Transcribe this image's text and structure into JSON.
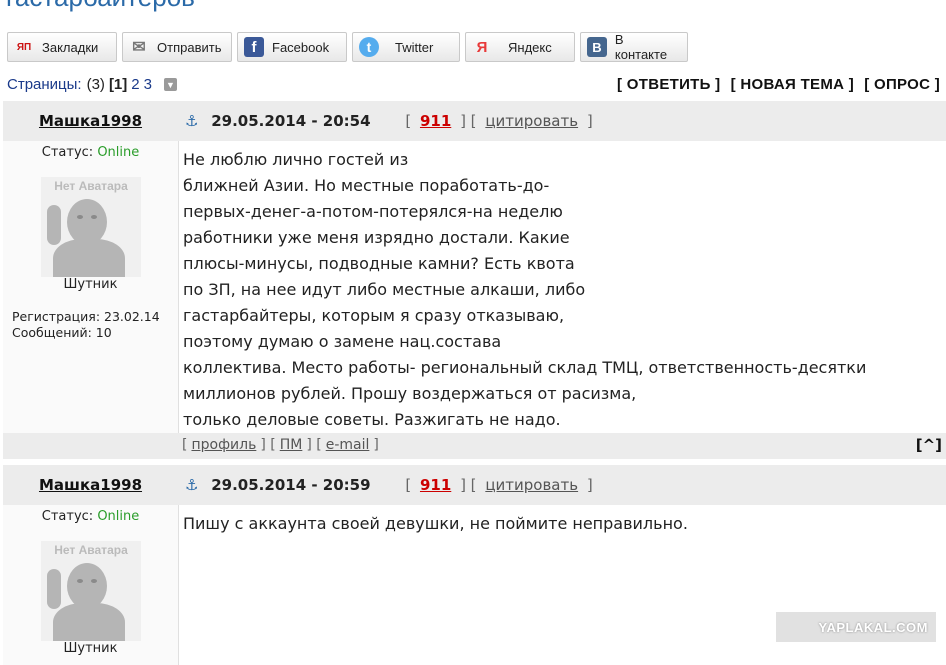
{
  "page": {
    "title_partial": "гастарбайтеров"
  },
  "share": [
    {
      "label": "Закладки",
      "icon": "yap-icon",
      "glyph": "ЯП",
      "color": "#cc1111"
    },
    {
      "label": "Отправить",
      "icon": "mail-icon",
      "glyph": "✉",
      "color": "#888888"
    },
    {
      "label": "Facebook",
      "icon": "facebook-icon",
      "glyph": "f",
      "color": "#3b5998"
    },
    {
      "label": "Twitter",
      "icon": "twitter-icon",
      "glyph": "t",
      "color": "#55acee"
    },
    {
      "label": "Яндекс",
      "icon": "yandex-icon",
      "glyph": "Я",
      "color": "#e83a3a"
    },
    {
      "label": "В контакте",
      "icon": "vk-icon",
      "glyph": "B",
      "color": "#45668e"
    }
  ],
  "pager": {
    "label": "Страницы:",
    "count": "(3)",
    "current": "[1]",
    "page2": "2",
    "page3": "3"
  },
  "actions": {
    "reply": "[ ОТВЕТИТЬ ]",
    "new_topic": "[ НОВАЯ ТЕМА ]",
    "poll": "[ ОПРОС ]"
  },
  "posts": [
    {
      "author": "Машка1998",
      "anchor": "⚓",
      "date": "29.05.2014 - 20:54",
      "open_bracket": "[",
      "number": "911",
      "separator": "] [",
      "cite": "цитировать",
      "close_bracket": "]",
      "status_label": "Статус:",
      "status_value": "Online",
      "no_avatar": "Нет Аватара",
      "rank": "Шутник",
      "reg": "Регистрация: 23.02.14",
      "msgs": "Сообщений: 10",
      "lines": [
        "Не люблю лично гостей из",
        "ближней Азии. Но местные поработать-до-",
        "первых-денег-а-потом-потерялся-на неделю",
        "работники уже меня изрядно достали. Какие",
        "плюсы-минусы, подводные камни? Есть квота",
        "по ЗП, на нее идут либо местные алкаши, либо",
        "гастарбайтеры, которым я сразу отказываю,",
        "поэтому думаю о замене нац.состава",
        "коллектива. Место работы- региональный склад ТМЦ, ответственность-десятки",
        "миллионов рублей. Прошу воздержаться от расизма,",
        "только деловые советы. Разжигать не надо."
      ],
      "foot": {
        "profile": "профиль",
        "pm": "ПМ",
        "email": "e-mail",
        "up": "[^]"
      }
    },
    {
      "author": "Машка1998",
      "anchor": "⚓",
      "date": "29.05.2014 - 20:59",
      "open_bracket": "[",
      "number": "911",
      "separator": "] [",
      "cite": "цитировать",
      "close_bracket": "]",
      "status_label": "Статус:",
      "status_value": "Online",
      "no_avatar": "Нет Аватара",
      "rank": "Шутник",
      "lines": [
        "Пишу с аккаунта своей девушки, не поймите неправильно."
      ]
    }
  ],
  "watermark": "YAPLAKAL.COM"
}
